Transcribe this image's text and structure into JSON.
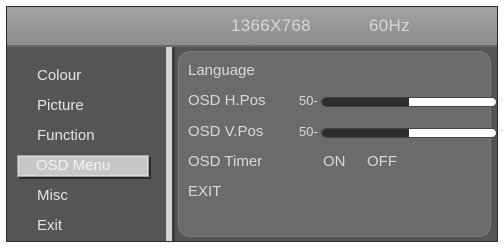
{
  "header": {
    "resolution": "1366X768",
    "refresh_rate": "60Hz"
  },
  "sidebar": {
    "items": [
      {
        "label": "Colour"
      },
      {
        "label": "Picture"
      },
      {
        "label": "Function"
      },
      {
        "label": "OSD Menu",
        "selected": true
      },
      {
        "label": "Misc"
      },
      {
        "label": "Exit"
      }
    ]
  },
  "panel": {
    "language_label": "Language",
    "h_pos": {
      "label": "OSD H.Pos",
      "value_text": "50-",
      "level": 0.5,
      "plus": "+"
    },
    "v_pos": {
      "label": "OSD V.Pos",
      "value_text": "50-",
      "level": 0.5,
      "plus": "+"
    },
    "timer": {
      "label": "OSD Timer",
      "on": "ON",
      "off": "OFF"
    },
    "exit_label": "EXIT"
  },
  "colors": {
    "background": "#555555",
    "header": "#9a9a9a",
    "panel": "#6b6b6b",
    "selected": "#c7c7c7"
  }
}
